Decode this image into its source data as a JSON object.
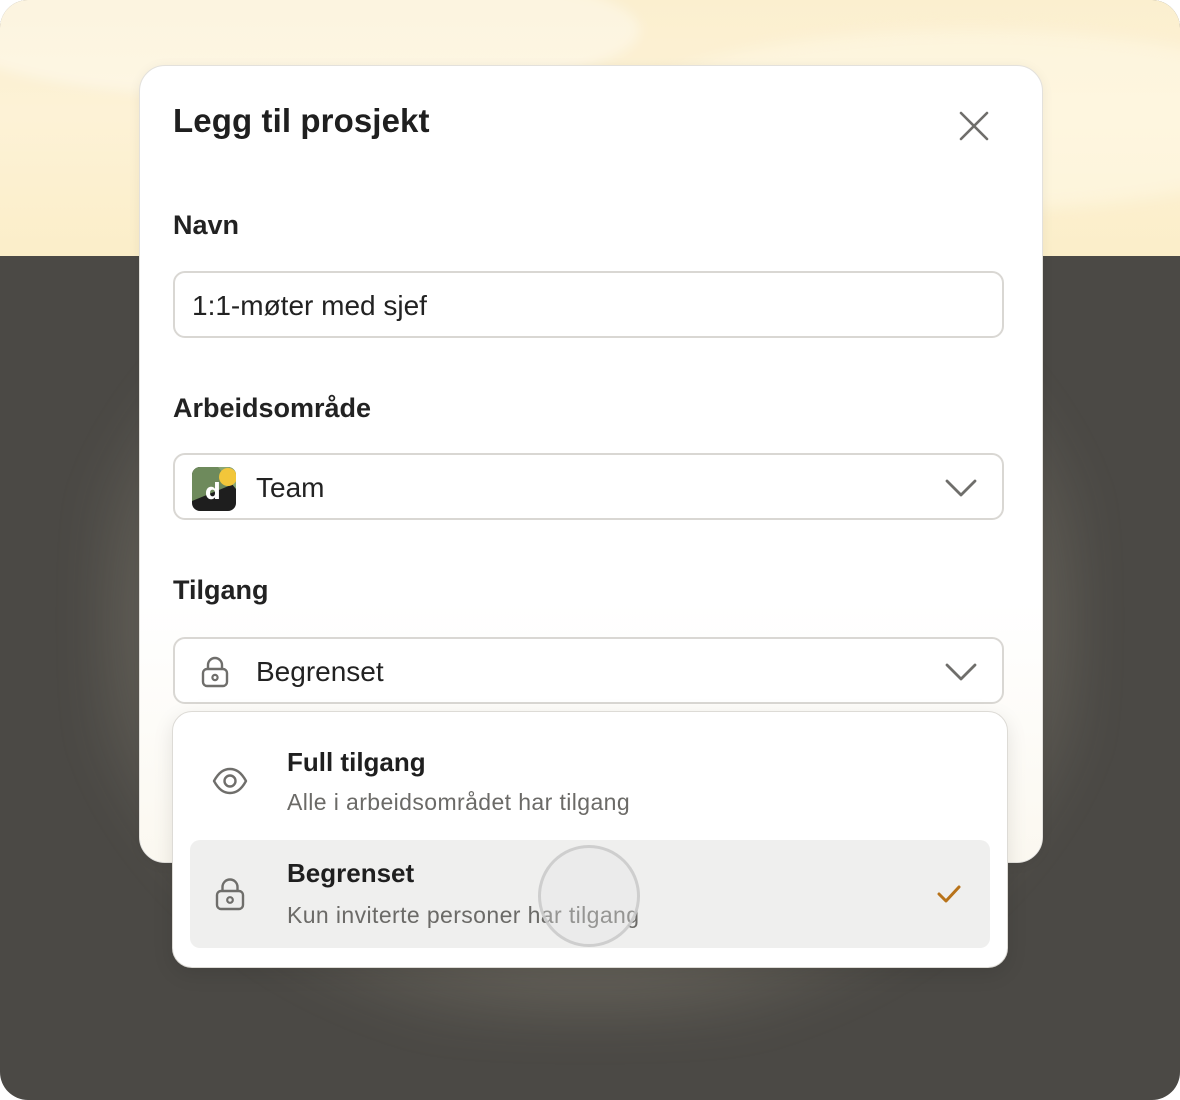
{
  "dialog": {
    "title": "Legg til prosjekt",
    "close_icon": "close-icon"
  },
  "fields": {
    "name": {
      "label": "Navn",
      "value": "1:1-møter med sjef"
    },
    "workspace": {
      "label": "Arbeidsområde",
      "value": "Team",
      "logo_letter": "d",
      "logo_colors": [
        "#6e8a5c",
        "#1e1e1e",
        "#f2c63a"
      ],
      "chevron_icon": "chevron-down-icon"
    },
    "access": {
      "label": "Tilgang",
      "value": "Begrenset",
      "icon": "lock-icon",
      "chevron_icon": "chevron-down-icon"
    }
  },
  "access_menu": {
    "options": [
      {
        "title": "Full tilgang",
        "description": "Alle i arbeidsområdet har tilgang",
        "icon": "eye-icon",
        "selected": false
      },
      {
        "title": "Begrenset",
        "description": "Kun inviterte personer har tilgang",
        "icon": "lock-icon",
        "selected": true
      }
    ],
    "check_icon": "check-icon",
    "check_color": "#b8731a"
  },
  "colors": {
    "background_top": "#fbefcf",
    "background_bottom": "#4b4945",
    "selected_row": "#efefee"
  }
}
